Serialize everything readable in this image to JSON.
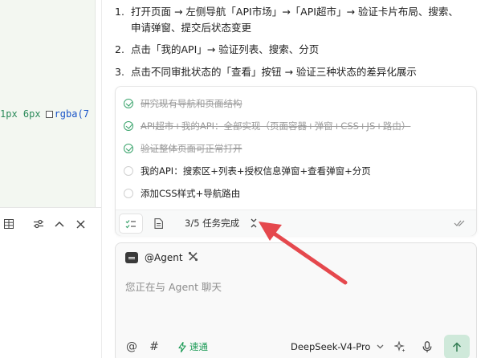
{
  "editor": {
    "code_fragment": "1px 6px",
    "code_fn": "rgba(7",
    "toolbar_icons": [
      "table-icon",
      "sliders-icon",
      "chevron-up-icon",
      "close-icon"
    ]
  },
  "steps": [
    {
      "num": "1.",
      "line1": "打开页面 → 左侧导航「API市场」→「API超市」→ 验证卡片布局、搜索、",
      "line2": "申请弹窗、提交后状态变更"
    },
    {
      "num": "2.",
      "line1": "点击「我的API」→ 验证列表、搜索、分页"
    },
    {
      "num": "3.",
      "line1": "点击不同审批状态的「查看」按钮 → 验证三种状态的差异化展示"
    }
  ],
  "tasks": {
    "items": [
      {
        "text": "研究现有导航和页面结构",
        "done": true
      },
      {
        "text": "API超市+我的API：全部实现（页面容器+弹窗+CSS+JS+路由）",
        "done": true
      },
      {
        "text": "验证整体页面可正常打开",
        "done": true
      },
      {
        "text": "我的API：搜索区+列表+授权信息弹窗+查看弹窗+分页",
        "done": false
      },
      {
        "text": "添加CSS样式+导航路由",
        "done": false
      }
    ],
    "count_label": "3/5 任务完成"
  },
  "agent": {
    "mention": "@Agent",
    "placeholder": "您正在与 Agent 聊天",
    "speed_label": "速通",
    "model_label": "DeepSeek-V4-Pro"
  },
  "colors": {
    "accent_green": "#39a36b",
    "annotation_red": "#e5484d",
    "send_bg": "#cfe9da"
  }
}
